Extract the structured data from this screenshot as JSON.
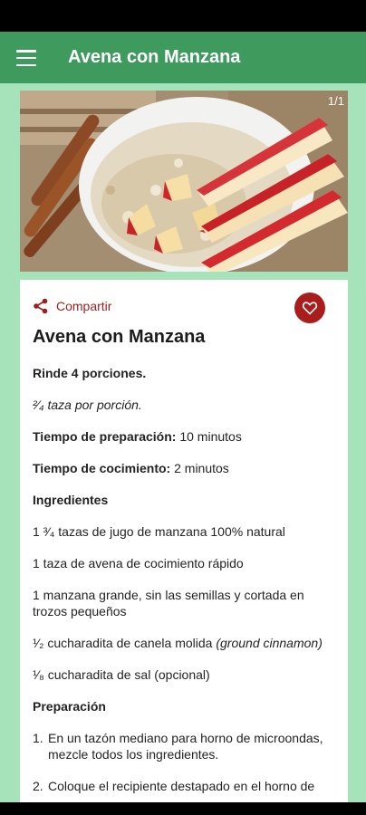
{
  "app_bar": {
    "title": "Avena con Manzana",
    "background": "#3e9a5d"
  },
  "gallery": {
    "page_indicator": "1/1"
  },
  "card": {
    "share_label": "Compartir",
    "title": "Avena con Manzana",
    "yield": "Rinde 4 porciones.",
    "portion": "²⁄₄ taza por porción.",
    "prep_label": "Tiempo de preparación:",
    "prep_value": " 10 minutos",
    "cook_label": "Tiempo de cocimiento:",
    "cook_value": " 2 minutos",
    "ingredients_heading": "Ingredientes",
    "ingredients": [
      "1 ³⁄₄ tazas de jugo de manzana 100% natural",
      "1 taza de avena de cocimiento rápido",
      "1 manzana grande, sin las semillas y cortada en trozos pequeños",
      "¹⁄₂ cucharadita de canela molida ",
      "¹⁄₈ cucharadita de sal (opcional)"
    ],
    "ingredient_4_note": "(ground cinnamon)",
    "preparation_heading": "Preparación",
    "steps": [
      {
        "num": "1.",
        "text": "En un tazón mediano para horno de microondas, mezcle todos los ingredientes."
      },
      {
        "num": "2.",
        "text": "Coloque el recipiente destapado en el horno de"
      }
    ]
  },
  "colors": {
    "page_background": "#a6e3bb",
    "accent_red": "#a91d1d"
  },
  "icons": {
    "menu": "hamburger-icon",
    "share": "share-icon",
    "favorite": "heart-icon"
  }
}
